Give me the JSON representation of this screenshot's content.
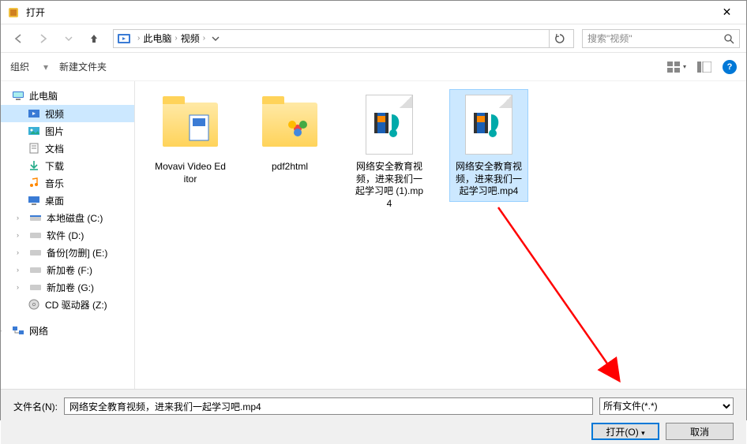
{
  "window": {
    "title": "打开"
  },
  "breadcrumb": {
    "root": "此电脑",
    "folder": "视频"
  },
  "search": {
    "placeholder": "搜索\"视频\""
  },
  "toolbar": {
    "organize": "组织",
    "newfolder": "新建文件夹"
  },
  "sidebar": {
    "pc": "此电脑",
    "items": [
      {
        "label": "视频",
        "icon": "video",
        "selected": true
      },
      {
        "label": "图片",
        "icon": "pictures"
      },
      {
        "label": "文档",
        "icon": "documents"
      },
      {
        "label": "下载",
        "icon": "downloads"
      },
      {
        "label": "音乐",
        "icon": "music"
      },
      {
        "label": "桌面",
        "icon": "desktop"
      },
      {
        "label": "本地磁盘 (C:)",
        "icon": "disk"
      },
      {
        "label": "软件 (D:)",
        "icon": "disk"
      },
      {
        "label": "备份[勿删] (E:)",
        "icon": "disk"
      },
      {
        "label": "新加卷 (F:)",
        "icon": "disk"
      },
      {
        "label": "新加卷 (G:)",
        "icon": "disk"
      },
      {
        "label": "CD 驱动器 (Z:)",
        "icon": "cd"
      }
    ],
    "network": "网络"
  },
  "files": [
    {
      "name": "Movavi Video Editor",
      "type": "folder"
    },
    {
      "name": "pdf2html",
      "type": "folder-color"
    },
    {
      "name": "网络安全教育视频，进来我们一起学习吧 (1).mp4",
      "type": "video"
    },
    {
      "name": "网络安全教育视频，进来我们一起学习吧.mp4",
      "type": "video",
      "selected": true
    }
  ],
  "bottom": {
    "filename_label": "文件名(N):",
    "filename_value": "网络安全教育视频，进来我们一起学习吧.mp4",
    "filter": "所有文件(*.*)",
    "open": "打开(O)",
    "cancel": "取消"
  }
}
